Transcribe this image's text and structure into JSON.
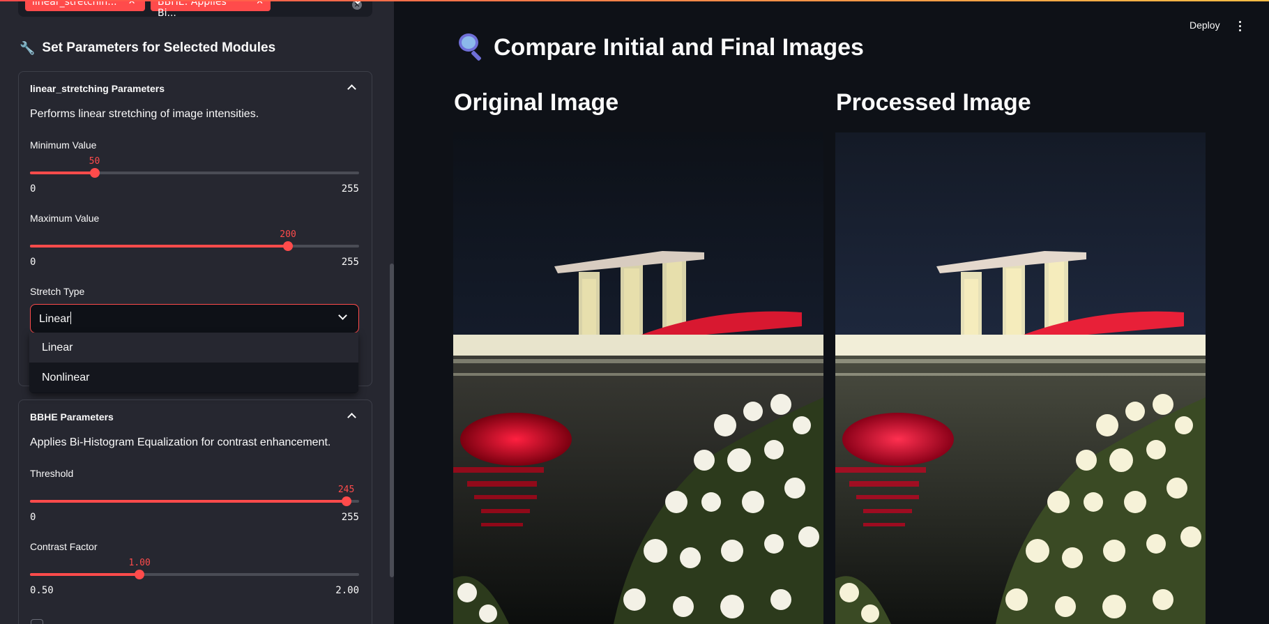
{
  "multiselect": {
    "chips": [
      {
        "label": "linear_stretchin..."
      },
      {
        "label": "BBHE: Applies Bi..."
      }
    ]
  },
  "sidebar": {
    "params_title": "Set Parameters for Selected Modules",
    "linear": {
      "header": "linear_stretching Parameters",
      "description": "Performs linear stretching of image intensities.",
      "min": {
        "label": "Minimum Value",
        "value": "50",
        "min": "0",
        "max": "255",
        "fraction": 0.196
      },
      "max": {
        "label": "Maximum Value",
        "value": "200",
        "min": "0",
        "max": "255",
        "fraction": 0.784
      },
      "stretch_label": "Stretch Type",
      "stretch_value": "Linear",
      "options": [
        "Linear",
        "Nonlinear"
      ]
    },
    "bbhe": {
      "header": "BBHE Parameters",
      "description": "Applies Bi-Histogram Equalization for contrast enhancement.",
      "threshold": {
        "label": "Threshold",
        "value": "245",
        "min": "0",
        "max": "255",
        "fraction": 0.961
      },
      "contrast": {
        "label": "Contrast Factor",
        "value": "1.00",
        "min": "0.50",
        "max": "2.00",
        "fraction": 0.333
      }
    }
  },
  "header": {
    "deploy": "Deploy"
  },
  "main": {
    "title": "Compare Initial and Final Images",
    "original_title": "Original Image",
    "processed_title": "Processed Image"
  },
  "colors": {
    "accent": "#ff4b4b",
    "sidebar_bg": "#262730",
    "main_bg": "#0e1117"
  }
}
